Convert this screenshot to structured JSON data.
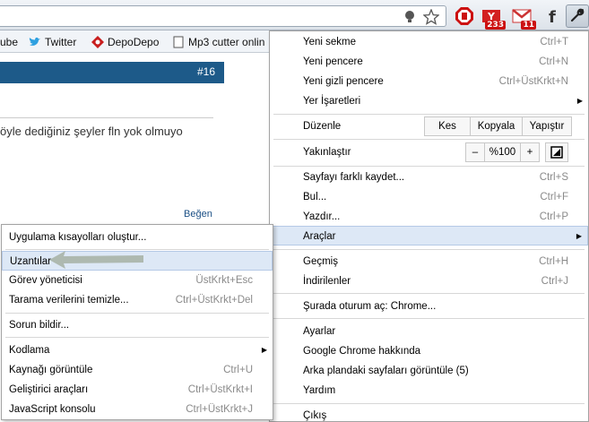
{
  "bookmarks": [
    {
      "label": "ube",
      "icon": "none"
    },
    {
      "label": "Twitter",
      "icon": "twitter-bird-icon"
    },
    {
      "label": "DepoDepo",
      "icon": "depodepo-icon"
    },
    {
      "label": "Mp3 cutter onlin",
      "icon": "page-icon"
    }
  ],
  "extensions": [
    {
      "name": "adblock-icon"
    },
    {
      "name": "yahoo-mail-icon",
      "badge": "233"
    },
    {
      "name": "gmail-icon",
      "badge": "11"
    },
    {
      "name": "facebook-icon"
    }
  ],
  "page": {
    "post_number": "#16",
    "post_text": "öyle dediğiniz şeyler fln yok olmuyo",
    "reply_link": "Beğen"
  },
  "main_menu": {
    "items": [
      {
        "label": "Yeni sekme",
        "shortcut": "Ctrl+T"
      },
      {
        "label": "Yeni pencere",
        "shortcut": "Ctrl+N"
      },
      {
        "label": "Yeni gizli pencere",
        "shortcut": "Ctrl+ÜstKrkt+N"
      },
      {
        "label": "Yer İşaretleri",
        "shortcut": ""
      },
      {
        "label": "Düzenle",
        "cut": "Kes",
        "copy": "Kopyala",
        "paste": "Yapıştır"
      },
      {
        "label": "Yakınlaştır",
        "zoom_out": "–",
        "zoom_level": "%100",
        "zoom_in": "+"
      },
      {
        "label": "Sayfayı farklı kaydet...",
        "shortcut": "Ctrl+S"
      },
      {
        "label": "Bul...",
        "shortcut": "Ctrl+F"
      },
      {
        "label": "Yazdır...",
        "shortcut": "Ctrl+P"
      },
      {
        "label": "Araçlar",
        "shortcut": ""
      },
      {
        "label": "Geçmiş",
        "shortcut": "Ctrl+H"
      },
      {
        "label": "İndirilenler",
        "shortcut": "Ctrl+J"
      },
      {
        "label": "Şurada oturum aç: Chrome...",
        "shortcut": ""
      },
      {
        "label": "Ayarlar",
        "shortcut": ""
      },
      {
        "label": "Google Chrome hakkında",
        "shortcut": ""
      },
      {
        "label": "Arka plandaki sayfaları görüntüle (5)",
        "shortcut": ""
      },
      {
        "label": "Yardım",
        "shortcut": ""
      },
      {
        "label": "Çıkış",
        "shortcut": ""
      }
    ]
  },
  "tools_menu": {
    "items": [
      {
        "label": "Uygulama kısayolları oluştur...",
        "shortcut": ""
      },
      {
        "label": "Uzantılar",
        "shortcut": ""
      },
      {
        "label": "Görev yöneticisi",
        "shortcut": "ÜstKrkt+Esc"
      },
      {
        "label": "Tarama verilerini temizle...",
        "shortcut": "Ctrl+ÜstKrkt+Del"
      },
      {
        "label": "Sorun bildir...",
        "shortcut": ""
      },
      {
        "label": "Kodlama",
        "shortcut": ""
      },
      {
        "label": "Kaynağı görüntüle",
        "shortcut": "Ctrl+U"
      },
      {
        "label": "Geliştirici araçları",
        "shortcut": "Ctrl+ÜstKrkt+I"
      },
      {
        "label": "JavaScript konsolu",
        "shortcut": "Ctrl+ÜstKrkt+J"
      }
    ]
  },
  "colors": {
    "post_header": "#1d5a89",
    "highlight": "#dde8f6",
    "link": "#1a4f85"
  }
}
